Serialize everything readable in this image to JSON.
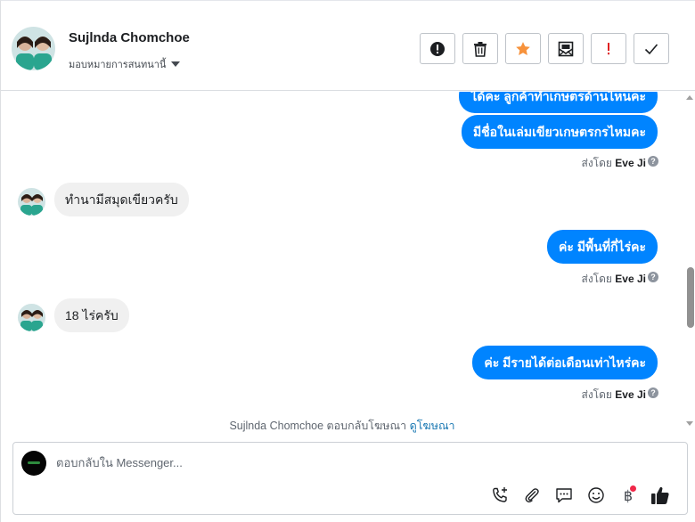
{
  "header": {
    "contact_name": "Sujlnda Chomchoe",
    "assign_label": "มอบหมายการสนทนานี้"
  },
  "actions": [
    {
      "name": "mark-spam-button",
      "icon": "alert-circle-icon"
    },
    {
      "name": "delete-button",
      "icon": "trash-icon"
    },
    {
      "name": "star-button",
      "icon": "star-icon",
      "color": "#f7923b"
    },
    {
      "name": "mark-unread-button",
      "icon": "envelope-icon"
    },
    {
      "name": "follow-up-button",
      "icon": "exclamation-icon",
      "color": "#e02020"
    },
    {
      "name": "mark-done-button",
      "icon": "check-icon"
    }
  ],
  "messages": {
    "m1": "ได้คะ ลูกค้าทำเกษตรด้านไหนคะ",
    "m2": "มีชื่อในเล่มเขียวเกษตรกรไหมคะ",
    "m3": "ทำนามีสมุดเขียวครับ",
    "m4": "ค่ะ มีพื้นที่กี่ไร่คะ",
    "m5": "18 ไร่ครับ",
    "m6": "ค่ะ มีรายได้ต่อเดือนเท่าไหร่คะ",
    "sent_by_prefix": "ส่งโดย",
    "sent_by_name": "Eve Ji",
    "help_glyph": "?",
    "replied_text": "Sujlnda Chomchoe ตอบกลับโฆษณา",
    "replied_link": "ดูโฆษณา"
  },
  "composer": {
    "placeholder": "ตอบกลับใน Messenger...",
    "baht_glyph": "฿",
    "tools": [
      "call-add-icon",
      "paperclip-icon",
      "saved-reply-icon",
      "emoji-icon",
      "baht-icon",
      "thumbs-up-icon"
    ]
  },
  "colors": {
    "outgoing_bubble": "#0084ff",
    "incoming_bubble": "#f0f0f0",
    "link": "#1877b2"
  }
}
